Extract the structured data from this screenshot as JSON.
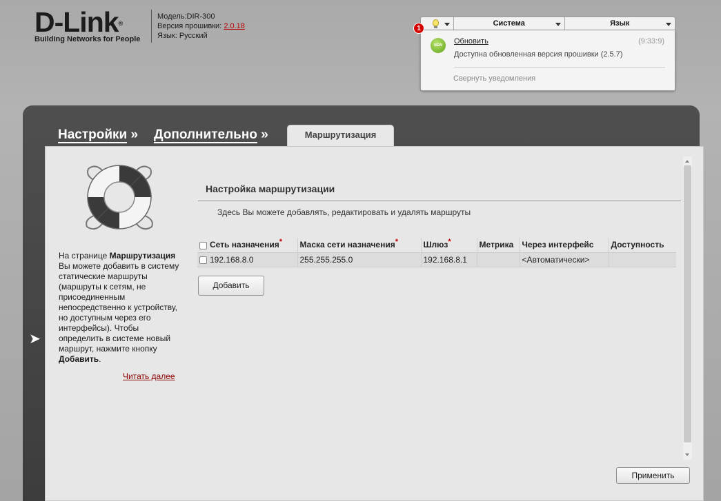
{
  "header": {
    "logo_text": "D-Link",
    "logo_tagline": "Building Networks for People",
    "model_label": "Модель:",
    "model_value": "DIR-300",
    "firmware_label": "Версия прошивки:",
    "firmware_value": "2.0.18",
    "language_label": "Язык:",
    "language_value": "Русский"
  },
  "topbar": {
    "notification_count": "1",
    "menu_system": "Система",
    "menu_language": "Язык"
  },
  "notifications": {
    "icon_label": "NEW",
    "title": "Обновить",
    "time": "(9:33:9)",
    "text": "Доступна обновленная версия прошивки (2.5.7)",
    "collapse": "Свернуть уведомления"
  },
  "breadcrumb": {
    "item1": "Настройки",
    "sep1": "»",
    "item2": "Дополнительно",
    "sep2": "»",
    "current": "Маршрутизация"
  },
  "help": {
    "p1": "На странице ",
    "p1_bold": "Маршрутизация",
    "p2": " Вы можете добавить в систему статические маршруты (маршруты к сетям, не присоединенным непосредственно к устройству, но доступным через его интерфейсы). Чтобы определить в системе новый маршрут, нажмите кнопку ",
    "p2_bold": "Добавить",
    "p3": ".",
    "read_more": "Читать далее"
  },
  "section": {
    "title": "Настройка маршрутизации",
    "description": "Здесь Вы можете добавлять, редактировать и удалять маршруты"
  },
  "table": {
    "columns": [
      "Сеть назначения",
      "Маска сети назначения",
      "Шлюз",
      "Метрика",
      "Через интерфейс",
      "Доступность"
    ],
    "required_mark": "*",
    "rows": [
      {
        "network": "192.168.8.0",
        "mask": "255.255.255.0",
        "gateway": "192.168.8.1",
        "metric": "",
        "interface": "<Автоматически>",
        "availability": ""
      }
    ]
  },
  "buttons": {
    "add": "Добавить",
    "apply": "Применить"
  }
}
